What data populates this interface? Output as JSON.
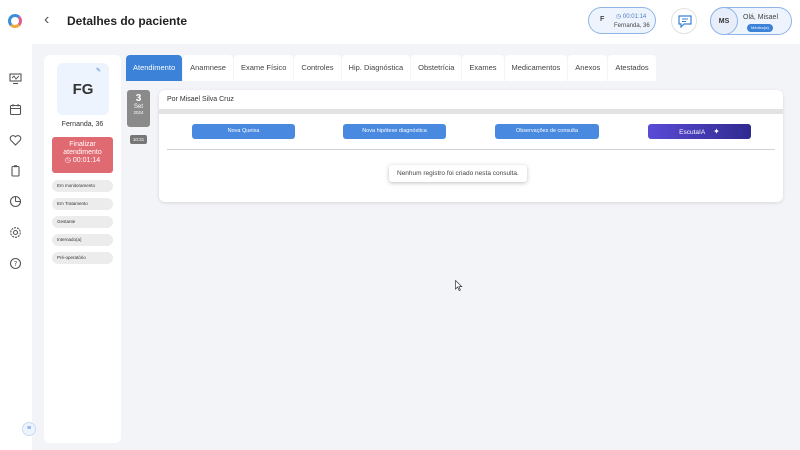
{
  "header": {
    "title": "Detalhes do paciente",
    "timer": {
      "letter": "F",
      "elapsed": "00:01:14",
      "patient": "Fernanda, 36"
    },
    "user": {
      "initials": "MS",
      "greeting": "Olá, Misael",
      "role": "Médico(a)"
    }
  },
  "patient": {
    "initials": "FG",
    "name": "Fernanda, 36",
    "finish": {
      "line1": "Finalizar",
      "line2": "atendimento",
      "elapsed": "00:01:14"
    },
    "tags": [
      "Em monitoramento",
      "Em Tratamento",
      "Gestante",
      "Internado(a)",
      "Pré-operatório"
    ]
  },
  "tabs": [
    "Atendimento",
    "Anamnese",
    "Exame Físico",
    "Controles",
    "Hip. Diagnóstica",
    "Obstetrícia",
    "Exames",
    "Medicamentos",
    "Anexos",
    "Atestados"
  ],
  "consultation": {
    "date": {
      "day": "3",
      "month": "Set",
      "year": "2024",
      "time": "10:31"
    },
    "author": "Por Misael Silva Cruz",
    "actions": {
      "new_complaint": "Nova Queixa",
      "new_hypothesis": "Nova hipótese diagnóstica",
      "notes": "Observações de consulta",
      "escuta": "EscutaIA"
    },
    "empty_message": "Nenhum registro foi criado nesta consulta."
  },
  "colors": {
    "accent": "#3b82d8",
    "finish": "#e06a72",
    "escuta_start": "#5a4bd6",
    "escuta_end": "#2f2a8f"
  }
}
